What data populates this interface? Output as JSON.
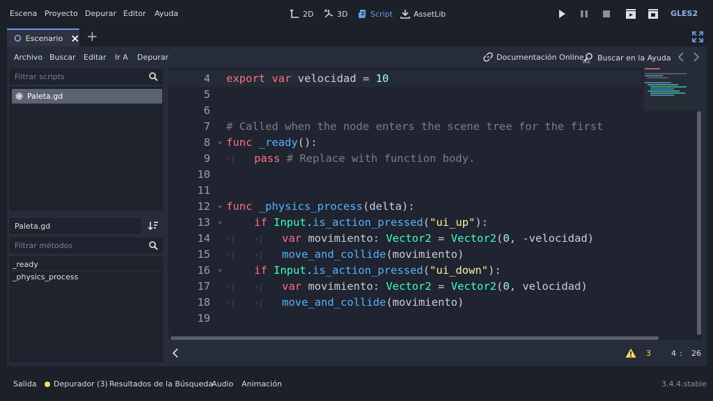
{
  "top_menu": [
    "Escena",
    "Proyecto",
    "Depurar",
    "Editor",
    "Ayuda"
  ],
  "workspaces": [
    {
      "label": "2D",
      "icon": "2d-icon"
    },
    {
      "label": "3D",
      "icon": "3d-icon"
    },
    {
      "label": "Script",
      "icon": "script-icon",
      "active": true
    },
    {
      "label": "AssetLib",
      "icon": "assetlib-icon"
    }
  ],
  "renderer": "GLES2",
  "scene_tab": {
    "label": "Escenario"
  },
  "script_menu": [
    "Archivo",
    "Buscar",
    "Editar",
    "Ir A",
    "Depurar"
  ],
  "help": {
    "online_docs": "Documentación Online",
    "search_help": "Buscar en la Ayuda"
  },
  "left_panel": {
    "filter_scripts_placeholder": "Filtrar scripts",
    "scripts": [
      "Paleta.gd"
    ],
    "current_script": "Paleta.gd",
    "filter_methods_placeholder": "Filtrar métodos",
    "methods": [
      "_ready",
      "_physics_process"
    ]
  },
  "editor": {
    "lines": [
      {
        "n": "4",
        "tokens": [
          [
            "kw",
            "export"
          ],
          [
            "tx",
            " "
          ],
          [
            "kw",
            "var"
          ],
          [
            "tx",
            " velocidad = "
          ],
          [
            "num",
            "10"
          ]
        ]
      },
      {
        "n": "5",
        "tokens": []
      },
      {
        "n": "6",
        "tokens": []
      },
      {
        "n": "7",
        "tokens": [
          [
            "cm",
            "# Called when the node enters the scene tree for the first"
          ]
        ]
      },
      {
        "n": "8",
        "fold": true,
        "tokens": [
          [
            "kw",
            "func"
          ],
          [
            "tx",
            " "
          ],
          [
            "fn",
            "_ready"
          ],
          [
            "tx",
            "():"
          ]
        ]
      },
      {
        "n": "9",
        "tabs": 1,
        "tokens": [
          [
            "kw",
            "pass"
          ],
          [
            "tx",
            " "
          ],
          [
            "cm",
            "# Replace with function body."
          ]
        ]
      },
      {
        "n": "10",
        "tokens": []
      },
      {
        "n": "11",
        "tokens": []
      },
      {
        "n": "12",
        "fold": true,
        "tokens": [
          [
            "kw",
            "func"
          ],
          [
            "tx",
            " "
          ],
          [
            "fn",
            "_physics_process"
          ],
          [
            "tx",
            "(delta):"
          ]
        ]
      },
      {
        "n": "13",
        "fold": true,
        "indent": 1,
        "tokens": [
          [
            "kw",
            "if"
          ],
          [
            "tx",
            " "
          ],
          [
            "ty",
            "Input"
          ],
          [
            "tx",
            "."
          ],
          [
            "fn",
            "is_action_pressed"
          ],
          [
            "tx",
            "("
          ],
          [
            "str",
            "\"ui_up\""
          ],
          [
            "tx",
            "):"
          ]
        ]
      },
      {
        "n": "14",
        "tabs": 2,
        "tokens": [
          [
            "kw",
            "var"
          ],
          [
            "tx",
            " movimiento: "
          ],
          [
            "ty",
            "Vector2"
          ],
          [
            "tx",
            " = "
          ],
          [
            "ty",
            "Vector2"
          ],
          [
            "tx",
            "("
          ],
          [
            "num",
            "0"
          ],
          [
            "tx",
            ", -velocidad)"
          ]
        ]
      },
      {
        "n": "15",
        "tabs": 2,
        "tokens": [
          [
            "fn",
            "move_and_collide"
          ],
          [
            "tx",
            "(movimiento)"
          ]
        ]
      },
      {
        "n": "16",
        "fold": true,
        "indent": 1,
        "tokens": [
          [
            "kw",
            "if"
          ],
          [
            "tx",
            " "
          ],
          [
            "ty",
            "Input"
          ],
          [
            "tx",
            "."
          ],
          [
            "fn",
            "is_action_pressed"
          ],
          [
            "tx",
            "("
          ],
          [
            "str",
            "\"ui_down\""
          ],
          [
            "tx",
            "):"
          ]
        ]
      },
      {
        "n": "17",
        "tabs": 2,
        "tokens": [
          [
            "kw",
            "var"
          ],
          [
            "tx",
            " movimiento: "
          ],
          [
            "ty",
            "Vector2"
          ],
          [
            "tx",
            " = "
          ],
          [
            "ty",
            "Vector2"
          ],
          [
            "tx",
            "("
          ],
          [
            "num",
            "0"
          ],
          [
            "tx",
            ", velocidad)"
          ]
        ]
      },
      {
        "n": "18",
        "tabs": 2,
        "tokens": [
          [
            "fn",
            "move_and_collide"
          ],
          [
            "tx",
            "(movimiento)"
          ]
        ]
      },
      {
        "n": "19",
        "tokens": []
      }
    ]
  },
  "status": {
    "warnings": "3",
    "line": "4",
    "sep": ":",
    "col": "26"
  },
  "bottom_tabs": [
    "Salida",
    "Depurador (3)",
    "Resultados de la Búsqueda",
    "Audio",
    "Animación"
  ],
  "version": "3.4.4.stable",
  "colors": {
    "accent": "#699ce8",
    "warning": "#ffdd65",
    "bg": "#1c2028",
    "panel": "#262c3a",
    "editor_bg": "#1f2430"
  }
}
